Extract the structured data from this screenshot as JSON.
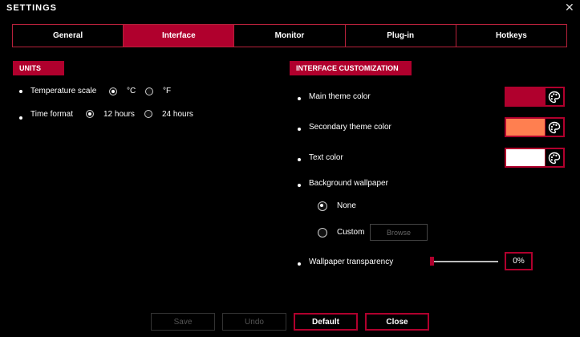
{
  "window": {
    "title": "SETTINGS",
    "close_glyph": "✕"
  },
  "tabs": [
    {
      "label": "General"
    },
    {
      "label": "Interface",
      "active": true
    },
    {
      "label": "Monitor"
    },
    {
      "label": "Plug-in"
    },
    {
      "label": "Hotkeys"
    }
  ],
  "units": {
    "heading": "UNITS",
    "temperature": {
      "label": "Temperature scale",
      "options": [
        "°C",
        "°F"
      ],
      "selected": "°C"
    },
    "time": {
      "label": "Time format",
      "options": [
        "12 hours",
        "24 hours"
      ],
      "selected": "12 hours"
    }
  },
  "customization": {
    "heading": "INTERFACE CUSTOMIZATION",
    "main_color": {
      "label": "Main theme color",
      "value": "#b0002d"
    },
    "secondary_color": {
      "label": "Secondary theme color",
      "value": "#ff7f50"
    },
    "text_color": {
      "label": "Text color",
      "value": "#ffffff"
    },
    "wallpaper": {
      "label": "Background wallpaper",
      "options": [
        "None",
        "Custom"
      ],
      "selected": "None",
      "browse_label": "Browse"
    },
    "transparency": {
      "label": "Wallpaper transparency",
      "value": 0,
      "display": "0%"
    }
  },
  "footer": {
    "save": "Save",
    "undo": "Undo",
    "default": "Default",
    "close": "Close"
  },
  "colors": {
    "accent": "#b0002d",
    "background": "#000000"
  }
}
